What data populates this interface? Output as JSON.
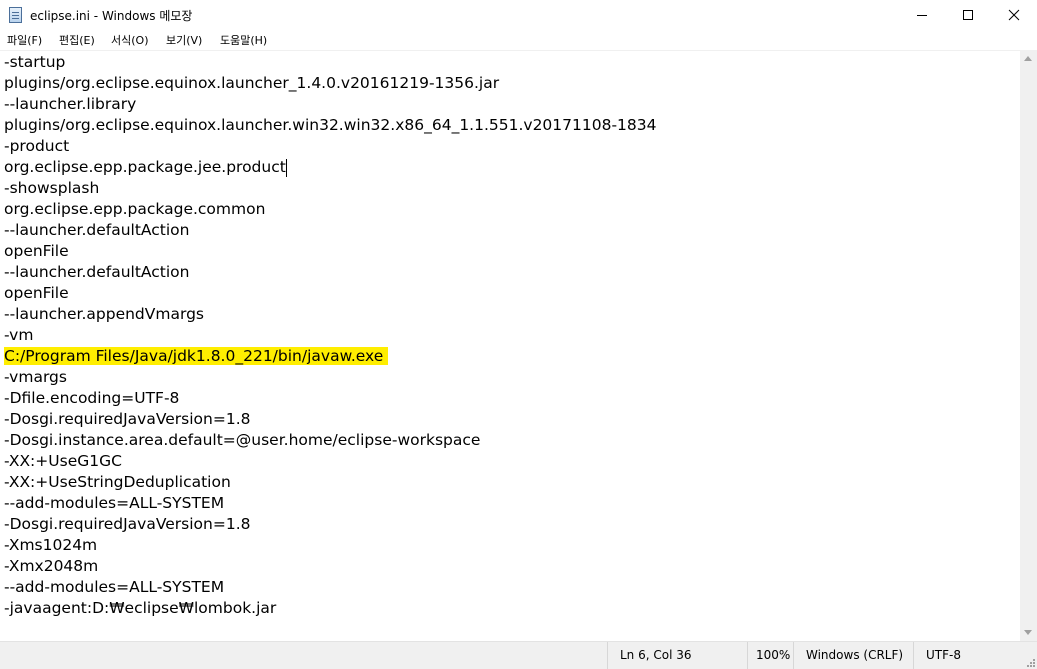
{
  "window": {
    "title": "eclipse.ini - Windows 메모장",
    "controls": [
      "minimize-icon",
      "maximize-icon",
      "close-icon"
    ]
  },
  "menu": {
    "file": "파일(F)",
    "edit": "편집(E)",
    "format": "서식(O)",
    "view": "보기(V)",
    "help": "도움말(H)"
  },
  "editor": {
    "highlight_color": "#ffee00",
    "lines": [
      "-startup",
      "plugins/org.eclipse.equinox.launcher_1.4.0.v20161219-1356.jar",
      "--launcher.library",
      "plugins/org.eclipse.equinox.launcher.win32.win32.x86_64_1.1.551.v20171108-1834",
      "-product",
      "org.eclipse.epp.package.jee.product",
      "-showsplash",
      "org.eclipse.epp.package.common",
      "--launcher.defaultAction",
      "openFile",
      "--launcher.defaultAction",
      "openFile",
      "--launcher.appendVmargs",
      "-vm",
      "C:/Program Files/Java/jdk1.8.0_221/bin/javaw.exe",
      "-vmargs",
      "-Dfile.encoding=UTF-8",
      "-Dosgi.requiredJavaVersion=1.8",
      "-Dosgi.instance.area.default=@user.home/eclipse-workspace",
      "-XX:+UseG1GC",
      "-XX:+UseStringDeduplication",
      "--add-modules=ALL-SYSTEM",
      "-Dosgi.requiredJavaVersion=1.8",
      "-Xms1024m",
      "-Xmx2048m",
      "--add-modules=ALL-SYSTEM",
      "-javaagent:D:₩eclipse₩lombok.jar"
    ]
  },
  "status": {
    "position": "Ln 6, Col 36",
    "zoom": "100%",
    "line_ending": "Windows (CRLF)",
    "encoding": "UTF-8"
  }
}
